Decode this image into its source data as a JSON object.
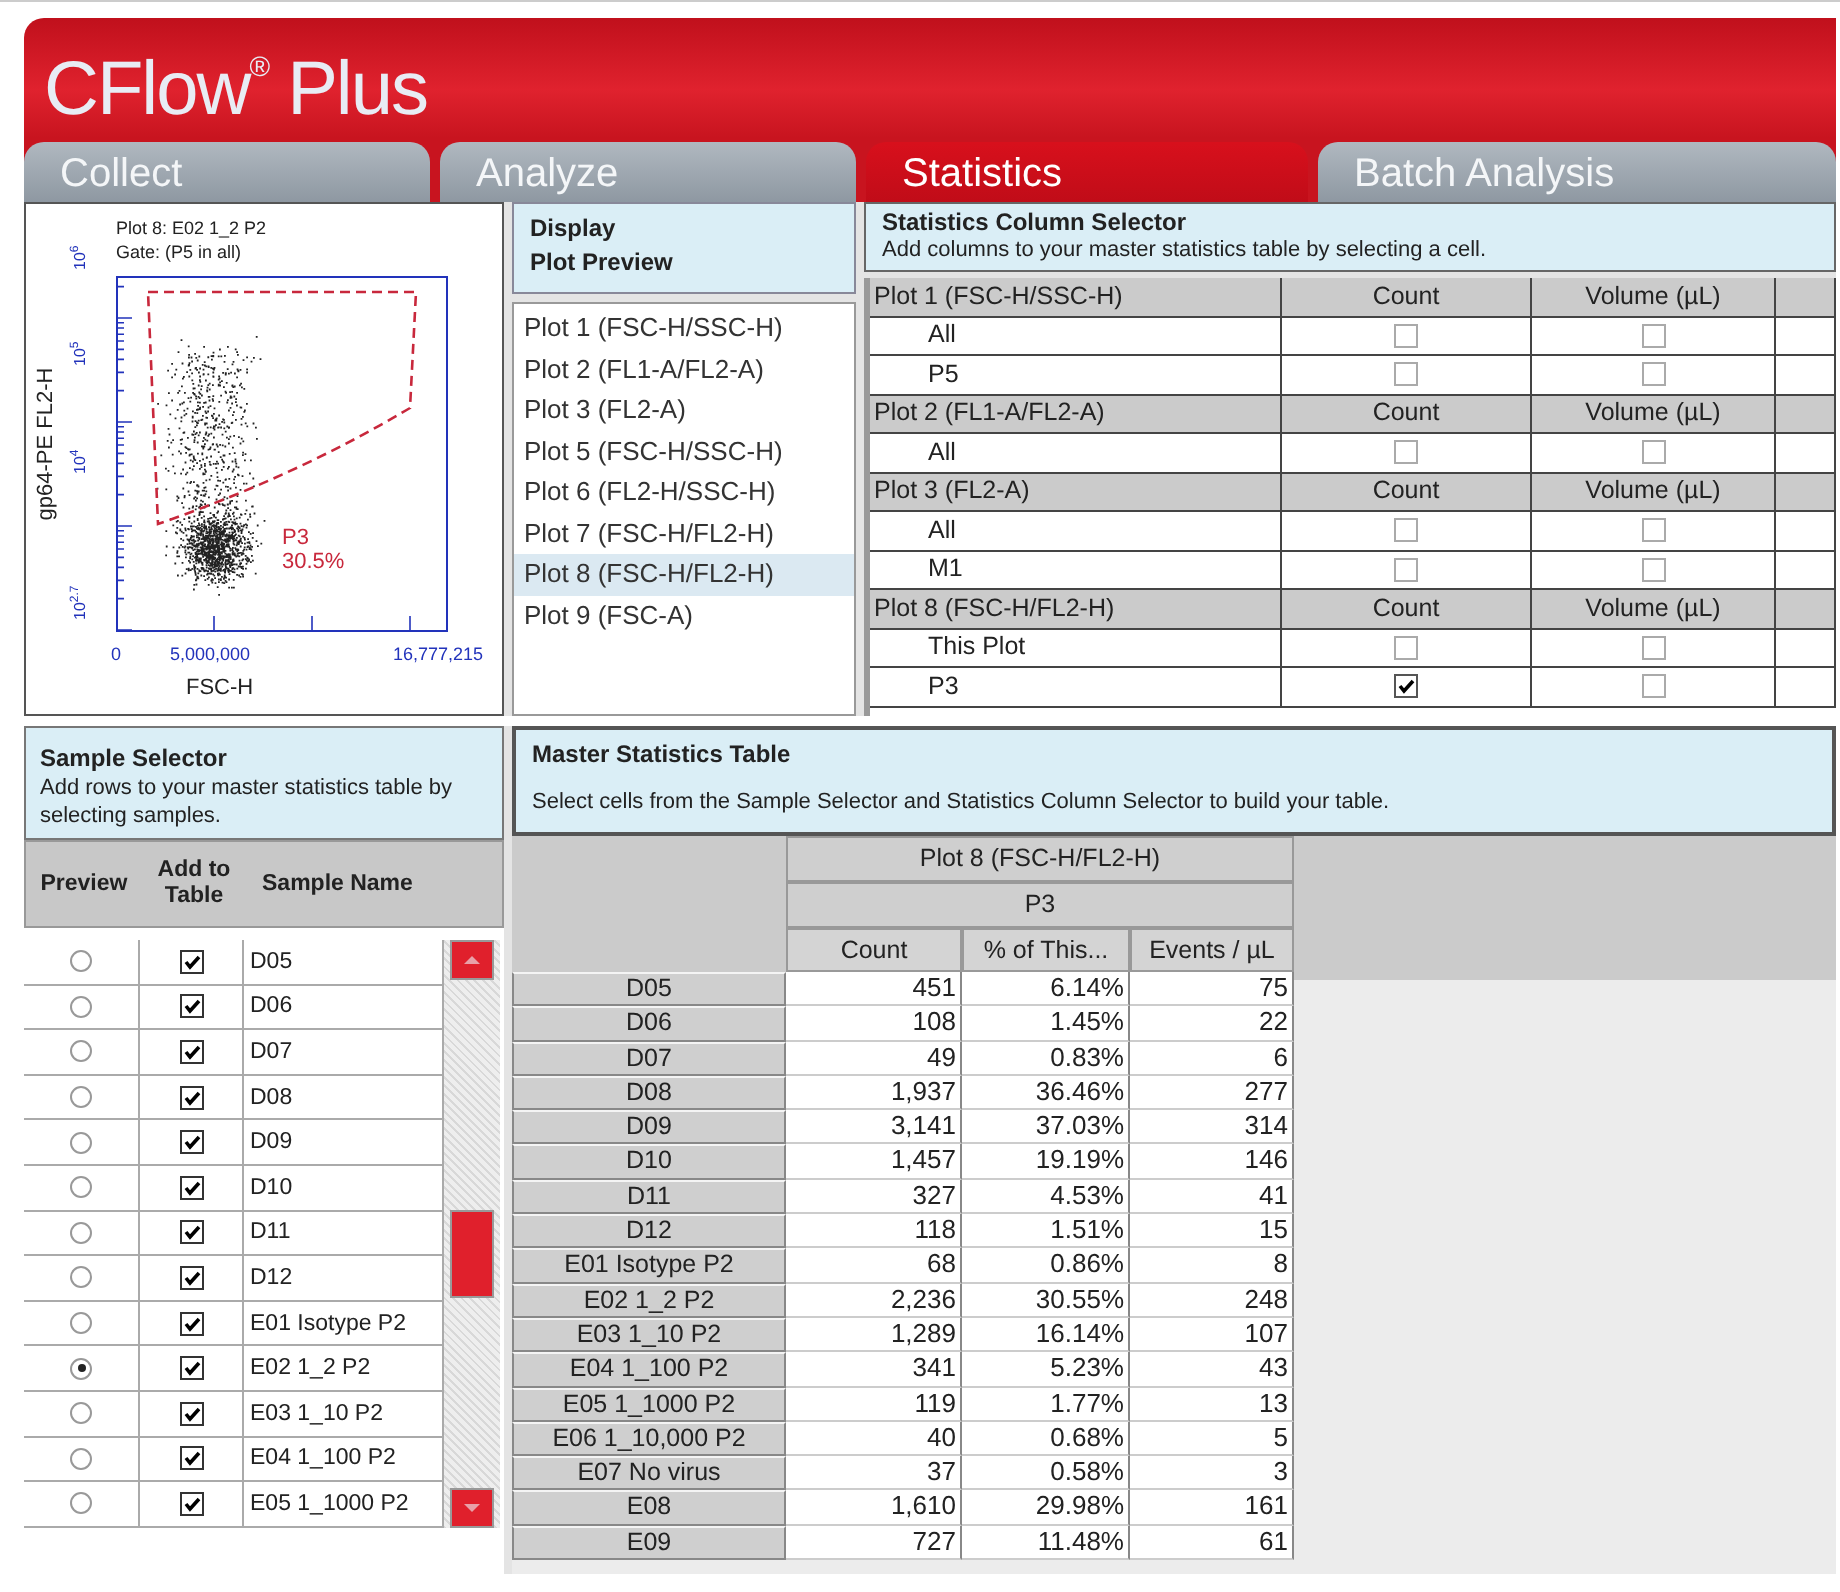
{
  "app": {
    "logo": "CFlow$^{®}$ Plus"
  },
  "tabs": [
    {
      "label": "Collect",
      "selected": false
    },
    {
      "label": "Analyze",
      "selected": false
    },
    {
      "label": "Statistics",
      "selected": true
    },
    {
      "label": "Batch Analysis",
      "selected": false
    }
  ],
  "plot_preview": {
    "title": "Plot 8: E02 1_2 P2",
    "gate": "Gate: (P5 in all)",
    "y_axis_label": "gp64-PE FL2-H",
    "y_ticks": [
      "10$^{2.7}$",
      "10$^{4}$",
      "10$^{5}$",
      "10$^{6}$"
    ],
    "x_ticks": [
      "0",
      "5,000,000",
      "16,777,215"
    ],
    "x_axis_label": "FSC-H",
    "gate_name": "P3",
    "gate_percent": "30.5%"
  },
  "plot_list": {
    "title": "Display",
    "subtitle": "Plot Preview",
    "items": [
      {
        "label": "Plot 1 (FSC-H/SSC-H)",
        "selected": false
      },
      {
        "label": "Plot 2 (FL1-A/FL2-A)",
        "selected": false
      },
      {
        "label": "Plot 3 (FL2-A)",
        "selected": false
      },
      {
        "label": "Plot 5 (FSC-H/SSC-H)",
        "selected": false
      },
      {
        "label": "Plot 6 (FL2-H/SSC-H)",
        "selected": false
      },
      {
        "label": "Plot 7 (FSC-H/FL2-H)",
        "selected": false
      },
      {
        "label": "Plot 8 (FSC-H/FL2-H)",
        "selected": true
      },
      {
        "label": "Plot 9 (FSC-A)",
        "selected": false
      }
    ]
  },
  "column_selector": {
    "title": "Statistics Column Selector",
    "hint": "Add columns to your master statistics table by selecting a cell.",
    "groups": [
      {
        "plot": "Plot 1 (FSC-H/SSC-H)",
        "columns": [
          "Count",
          "Volume (µL)"
        ],
        "rows": [
          {
            "gate": "All",
            "count": false,
            "volume": false
          },
          {
            "gate": "P5",
            "count": false,
            "volume": false
          }
        ]
      },
      {
        "plot": "Plot 2 (FL1-A/FL2-A)",
        "columns": [
          "Count",
          "Volume (µL)"
        ],
        "rows": [
          {
            "gate": "All",
            "count": false,
            "volume": false
          }
        ]
      },
      {
        "plot": "Plot 3 (FL2-A)",
        "columns": [
          "Count",
          "Volume (µL)"
        ],
        "rows": [
          {
            "gate": "All",
            "count": false,
            "volume": false
          },
          {
            "gate": "M1",
            "count": false,
            "volume": false
          }
        ]
      },
      {
        "plot": "Plot 8 (FSC-H/FL2-H)",
        "columns": [
          "Count",
          "Volume (µL)"
        ],
        "rows": [
          {
            "gate": "This Plot",
            "count": false,
            "volume": false
          },
          {
            "gate": "P3",
            "count": true,
            "volume": false
          }
        ]
      }
    ]
  },
  "sample_selector": {
    "title": "Sample Selector",
    "hint": "Add rows to your master statistics table by selecting samples.",
    "columns": [
      "Preview",
      "Add to Table",
      "Sample Name"
    ],
    "rows": [
      {
        "name": "D05",
        "preview": false,
        "add": true
      },
      {
        "name": "D06",
        "preview": false,
        "add": true
      },
      {
        "name": "D07",
        "preview": false,
        "add": true
      },
      {
        "name": "D08",
        "preview": false,
        "add": true
      },
      {
        "name": "D09",
        "preview": false,
        "add": true
      },
      {
        "name": "D10",
        "preview": false,
        "add": true
      },
      {
        "name": "D11",
        "preview": false,
        "add": true
      },
      {
        "name": "D12",
        "preview": false,
        "add": true
      },
      {
        "name": "E01 Isotype P2",
        "preview": false,
        "add": true
      },
      {
        "name": "E02 1_2 P2",
        "preview": true,
        "add": true
      },
      {
        "name": "E03 1_10 P2",
        "preview": false,
        "add": true
      },
      {
        "name": "E04 1_100 P2",
        "preview": false,
        "add": true
      },
      {
        "name": "E05 1_1000 P2",
        "preview": false,
        "add": true
      }
    ]
  },
  "master_table": {
    "title": "Master Statistics Table",
    "hint": "Select cells from the Sample Selector and Statistics Column Selector to build your table.",
    "plot_header": "Plot 8 (FSC-H/FL2-H)",
    "gate_header": "P3",
    "columns": [
      "Count",
      "% of This...",
      "Events / µL"
    ],
    "rows": [
      {
        "sample": "D05",
        "values": [
          "451",
          "6.14%",
          "75"
        ]
      },
      {
        "sample": "D06",
        "values": [
          "108",
          "1.45%",
          "22"
        ]
      },
      {
        "sample": "D07",
        "values": [
          "49",
          "0.83%",
          "6"
        ]
      },
      {
        "sample": "D08",
        "values": [
          "1,937",
          "36.46%",
          "277"
        ]
      },
      {
        "sample": "D09",
        "values": [
          "3,141",
          "37.03%",
          "314"
        ]
      },
      {
        "sample": "D10",
        "values": [
          "1,457",
          "19.19%",
          "146"
        ]
      },
      {
        "sample": "D11",
        "values": [
          "327",
          "4.53%",
          "41"
        ]
      },
      {
        "sample": "D12",
        "values": [
          "118",
          "1.51%",
          "15"
        ]
      },
      {
        "sample": "E01 Isotype P2",
        "values": [
          "68",
          "0.86%",
          "8"
        ]
      },
      {
        "sample": "E02 1_2 P2",
        "values": [
          "2,236",
          "30.55%",
          "248"
        ]
      },
      {
        "sample": "E03 1_10 P2",
        "values": [
          "1,289",
          "16.14%",
          "107"
        ]
      },
      {
        "sample": "E04 1_100 P2",
        "values": [
          "341",
          "5.23%",
          "43"
        ]
      },
      {
        "sample": "E05 1_1000 P2",
        "values": [
          "119",
          "1.77%",
          "13"
        ]
      },
      {
        "sample": "E06 1_10,000 P2",
        "values": [
          "40",
          "0.68%",
          "5"
        ]
      },
      {
        "sample": "E07 No virus",
        "values": [
          "37",
          "0.58%",
          "3"
        ]
      },
      {
        "sample": "E08",
        "values": [
          "1,610",
          "29.98%",
          "161"
        ]
      },
      {
        "sample": "E09",
        "values": [
          "727",
          "11.48%",
          "61"
        ]
      }
    ]
  }
}
